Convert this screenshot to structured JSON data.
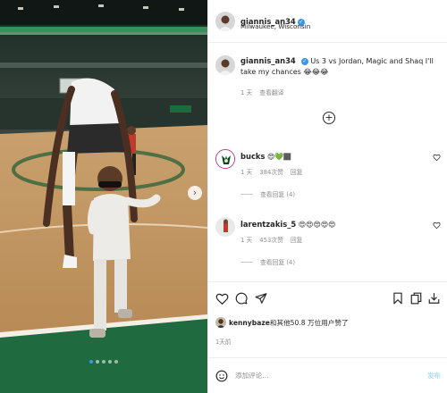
{
  "post": {
    "username": "giannis_an34",
    "location": "Milwaukee, Wisconsin",
    "verified_mark": "✓",
    "caption_text": "Us 3 vs Jordan, Magic and Shaq I'll take my chances 😂😂😂",
    "caption_age": "1 天",
    "translate_label": "查看翻译",
    "carousel": {
      "slides": 5,
      "active_index": 0
    },
    "next_glyph": "›"
  },
  "load_more_glyph": "+",
  "comments": [
    {
      "username": "bucks",
      "text": "😍💚🏾",
      "age": "1 天",
      "likes": "384次赞",
      "reply_label": "回复",
      "view_replies": "查看回复 (4)"
    },
    {
      "username": "larentzakis_5",
      "text": "😍😍😍😍😍",
      "age": "1 天",
      "likes": "453次赞",
      "reply_label": "回复",
      "view_replies": "查看回复 (4)"
    }
  ],
  "liked_by": {
    "name": "kennybaze",
    "rest": "和其他50.8 万位用户赞了"
  },
  "post_time": "1天前",
  "comment_box": {
    "placeholder": "添加评论...",
    "post_label": "发布"
  },
  "icons": {
    "heart": "heart-icon",
    "comment": "comment-icon",
    "share": "share-icon",
    "bookmark": "bookmark-icon",
    "copy": "copy-icon",
    "download": "download-icon",
    "emoji": "emoji-icon"
  },
  "colors": {
    "verified": "#3897f0",
    "bucks_green": "#00471b",
    "post_button": "#b2dffc"
  }
}
